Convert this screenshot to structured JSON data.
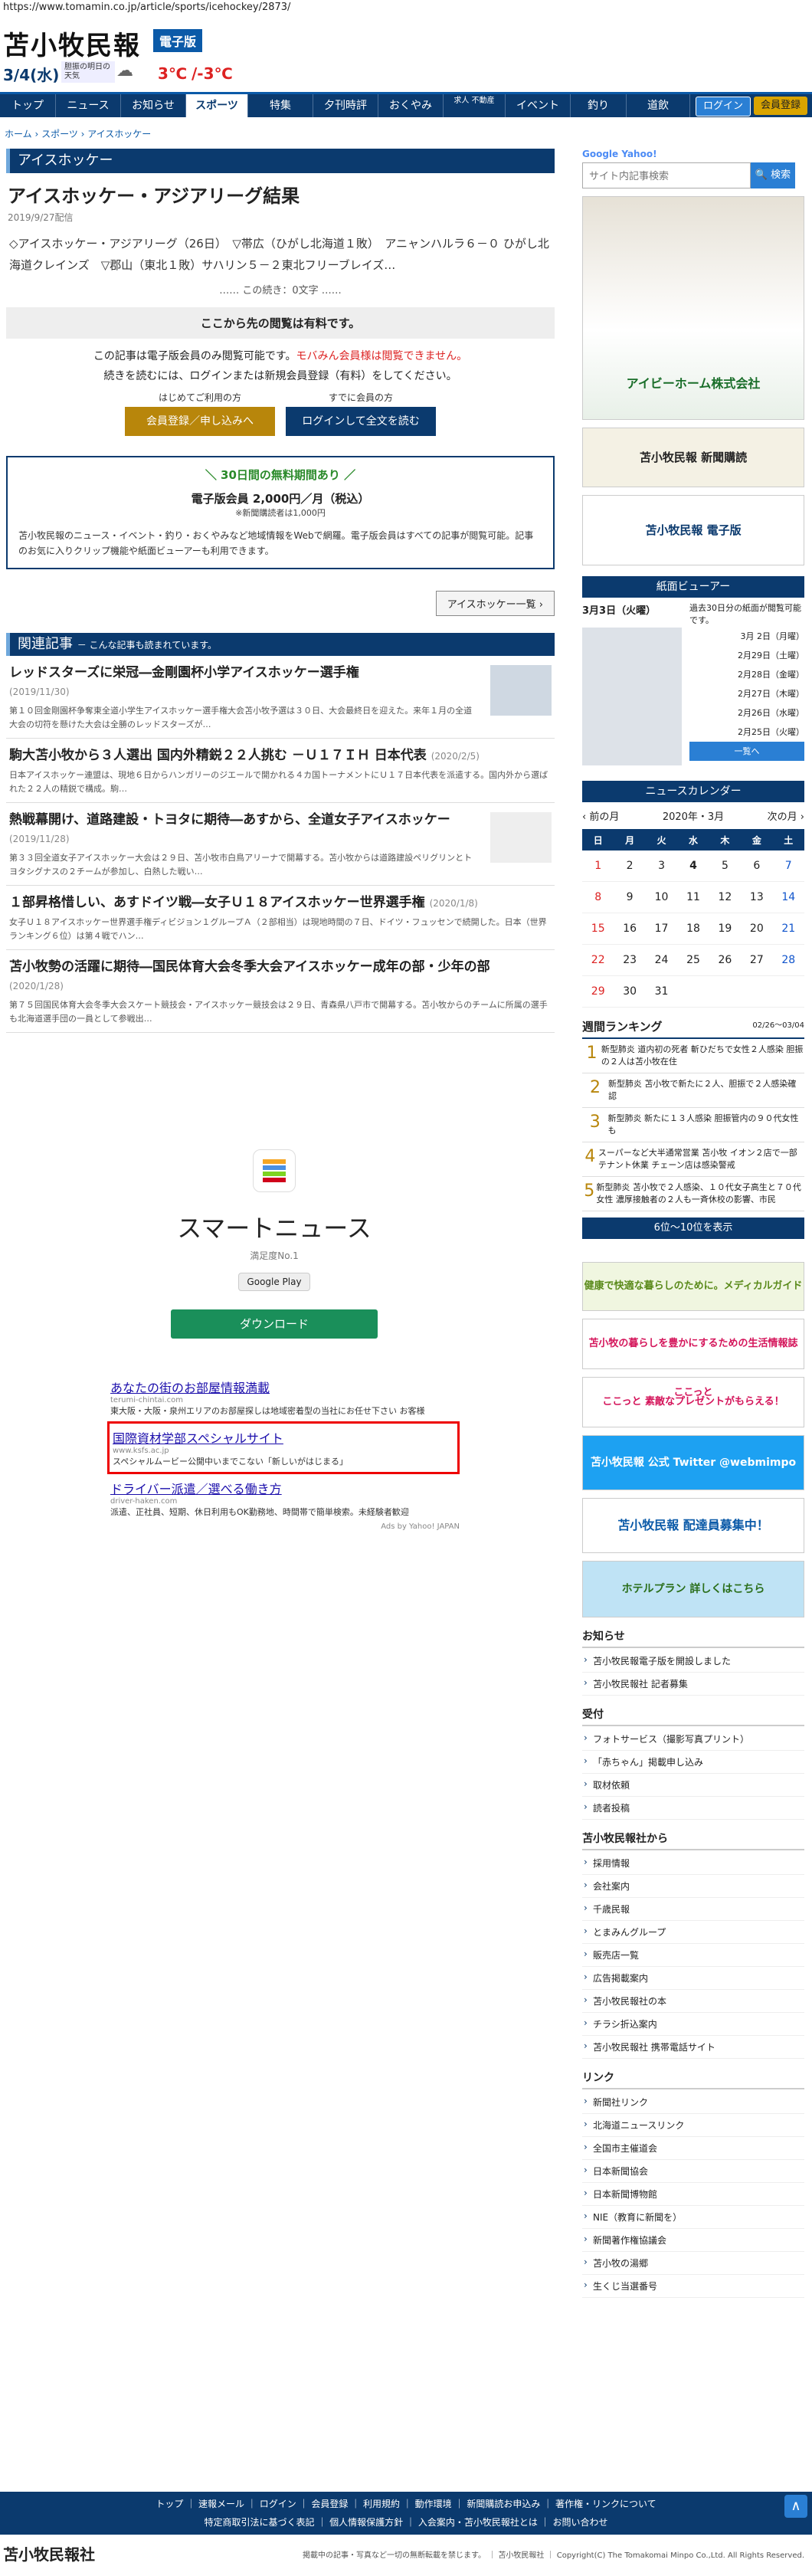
{
  "url": "https://www.tomamin.co.jp/article/sports/icehockey/2873/",
  "masthead": {
    "logo": "苫小牧民報",
    "edition": "電子版",
    "weather_date": "3/4(水)",
    "weather_label": "胆振の明日の天気",
    "temp_high": "3℃",
    "temp_low": "/-3℃"
  },
  "nav": {
    "items": [
      "トップ",
      "ニュース",
      "お知らせ",
      "スポーツ",
      "特集",
      "夕刊時評",
      "おくやみ",
      "求人 不動産",
      "イベント",
      "釣り",
      "道飲"
    ],
    "login": "ログイン",
    "member": "会員登録"
  },
  "breadcrumb": "ホーム › スポーツ › アイスホッケー",
  "section": "アイスホッケー",
  "article": {
    "title": "アイスホッケー・アジアリーグ結果",
    "date": "2019/9/27配信",
    "lead": "◇アイスホッケー・アジアリーグ（26日）　▽帯広（ひがし北海道１敗）　アニャンハルラ６－０ ひがし北海道クレインズ　▽郡山（東北１敗）サハリン５－２東北フリーブレイズ…",
    "chars": "…… この続き：0文字 ……",
    "paywall": "ここから先の閲覧は有料です。",
    "paytext_a": "この記事は電子版会員のみ閲覧可能です。",
    "paytext_red": "モバみん会員様は閲覧できません。",
    "paytext_b": "続きを読むには、ログインまたは新規会員登録（有料）をしてください。",
    "first_label": "はじめてご利用の方",
    "first_btn": "会員登録／申し込みへ",
    "member_label": "すでに会員の方",
    "member_btn": "ログインして全文を読む",
    "trial_title": "＼ 30日間の無料期間あり ／",
    "trial_price": "電子版会員 2,000円／月（税込）",
    "trial_note": "※新聞購読者は1,000円",
    "trial_desc": "苫小牧民報のニュース・イベント・釣り・おくやみなど地域情報をWebで網羅。電子版会員はすべての記事が閲覧可能。記事のお気に入りクリップ機能や紙面ビューアーも利用できます。",
    "back_btn": "アイスホッケー一覧 ›"
  },
  "related": {
    "header": "関連記事",
    "sub": "－ こんな記事も読まれています。",
    "items": [
      {
        "title": "レッドスターズに栄冠―金剛園杯小学アイスホッケー選手権",
        "date": "(2019/11/30)",
        "text": "第１０回金剛園杯争奪東全道小学生アイスホッケー選手権大会苫小牧予選は３０日、大会最終日を迎えた。来年１月の全道大会の切符を懸けた大会は全勝のレッドスターズが…"
      },
      {
        "title": "駒大苫小牧から３人選出 国内外精鋭２２人挑む －Ｕ１７ＩＨ 日本代表",
        "date": "(2020/2/5)",
        "text": "日本アイスホッケー連盟は、現地６日からハンガリーのジエールで開かれる４カ国トーナメントにＵ１７日本代表を派遣する。国内外から選ばれた２２人の精鋭で構成。駒…"
      },
      {
        "title": "熱戦幕開け、道路建設・トヨタに期待―あすから、全道女子アイスホッケー",
        "date": "(2019/11/28)",
        "text": "第３３回全道女子アイスホッケー大会は２９日、苫小牧市白鳥アリーナで開幕する。苫小牧からは道路建設ペリグリンとトヨタシグナスの２チームが参加し、白熱した戦い…"
      },
      {
        "title": "１部昇格惜しい、あすドイツ戦―女子Ｕ１８アイスホッケー世界選手権",
        "date": "(2020/1/8)",
        "text": "女子Ｕ１８アイスホッケー世界選手権ディビジョン１グループＡ（２部相当）は現地時間の７日、ドイツ・フュッセンで続開した。日本（世界ランキング６位）は第４戦でハン…"
      },
      {
        "title": "苫小牧勢の活躍に期待―国民体育大会冬季大会アイスホッケー成年の部・少年の部",
        "date": "(2020/1/28)",
        "text": "第７５回国民体育大会冬季大会スケート競技会・アイスホッケー競技会は２９日、青森県八戸市で開幕する。苫小牧からのチームに所属の選手も北海道選手団の一員として参戦出…"
      }
    ]
  },
  "smartnews": {
    "title": "スマートニュース",
    "sub": "満足度No.1",
    "gplay": "Google Play",
    "download": "ダウンロード"
  },
  "ads": {
    "items": [
      {
        "title": "あなたの街のお部屋情報満載",
        "url": "terumi-chintai.com",
        "text": "東大阪・大阪・泉州エリアのお部屋探しは地域密着型の当社にお任せ下さい お客様"
      },
      {
        "title": "国際資材学部スペシャルサイト",
        "url": "www.ksfs.ac.jp",
        "text": "スペシャルムービー公開中いまでこない「新しいがはじまる」"
      },
      {
        "title": "ドライバー派遣／選べる働き方",
        "url": "driver-haken.com",
        "text": "派遣、正社員、短期、休日利用もOK勤務地、時間帯で簡単検索。未経験者歓迎"
      }
    ],
    "footer": "Ads by Yahoo! JAPAN"
  },
  "side": {
    "search_brand": "Google Yahoo!",
    "search_placeholder": "サイト内記事検索",
    "search_btn": "検索",
    "ad1": "アイビーホーム株式会社",
    "ad2": "苫小牧民報 新聞購読",
    "ad3": "苫小牧民報 電子版",
    "viewer_title": "紙面ビューアー",
    "viewer_date": "3月3日（火曜）",
    "viewer_note": "過去30日分の紙面が閲覧可能です。",
    "viewer_list": [
      "3月 2日（月曜）",
      "2月29日（土曜）",
      "2月28日（金曜）",
      "2月27日（木曜）",
      "2月26日（水曜）",
      "2月25日（火曜）"
    ],
    "viewer_more": "一覧へ",
    "cal_title": "ニュースカレンダー",
    "cal_prev": "‹ 前の月",
    "cal_month": "2020年・3月",
    "cal_next": "次の月 ›",
    "cal_week": [
      "日",
      "月",
      "火",
      "水",
      "木",
      "金",
      "土"
    ],
    "cal_days": [
      [
        "1",
        "2",
        "3",
        "4",
        "5",
        "6",
        "7"
      ],
      [
        "8",
        "9",
        "10",
        "11",
        "12",
        "13",
        "14"
      ],
      [
        "15",
        "16",
        "17",
        "18",
        "19",
        "20",
        "21"
      ],
      [
        "22",
        "23",
        "24",
        "25",
        "26",
        "27",
        "28"
      ],
      [
        "29",
        "30",
        "31",
        "",
        "",
        "",
        ""
      ]
    ],
    "rank_title": "週間ランキング",
    "rank_range": "02/26～03/04",
    "rank_items": [
      {
        "n": "1",
        "t": "新型肺炎 道内初の死者 斬ひだちで女性２人感染 胆振の２人は苫小牧在住"
      },
      {
        "n": "2",
        "t": "新型肺炎 苫小牧で新たに２人、胆振で２人感染確認"
      },
      {
        "n": "3",
        "t": "新型肺炎 新たに１３人感染 胆振管内の９０代女性も"
      },
      {
        "n": "4",
        "t": "スーパーなど大半通常営業 苫小牧 イオン２店で一部テナント休業 チェーン店は感染警戒"
      },
      {
        "n": "5",
        "t": "新型肺炎 苫小牧で２人感染、１０代女子高生と７０代女性 濃厚接触者の２人も一斉休校の影響、市民"
      }
    ],
    "rank_more": "6位～10位を表示",
    "banners": [
      "健康で快適な暮らしのために。メディカルガイド",
      "苫小牧の暮らしを豊かにするための生活情報誌 ここっと",
      "ここっと 素敵なプレゼントがもらえる！",
      "苫小牧民報 公式 Twitter @webmimpo",
      "苫小牧民報 配達員募集中！",
      "ホテルプラン 詳しくはこちら"
    ],
    "links": [
      {
        "h": "お知らせ",
        "items": [
          "苫小牧民報電子版を開設しました",
          "苫小牧民報社 記者募集"
        ]
      },
      {
        "h": "受付",
        "items": [
          "フォトサービス（撮影写真プリント）",
          "「赤ちゃん」掲載申し込み",
          "取材依頼",
          "読者投稿"
        ]
      },
      {
        "h": "苫小牧民報社から",
        "items": [
          "採用情報",
          "会社案内",
          "千歳民報",
          "とまみんグループ",
          "販売店一覧",
          "広告掲載案内",
          "苫小牧民報社の本",
          "チラシ折込案内",
          "苫小牧民報社 携帯電話サイト"
        ]
      },
      {
        "h": "リンク",
        "items": [
          "新聞社リンク",
          "北海道ニュースリンク",
          "全国市主催道会",
          "日本新聞協会",
          "日本新聞博物館",
          "NIE（教育に新聞を）",
          "新聞著作権協議会",
          "苫小牧の湯郷",
          "生くじ当選番号"
        ]
      }
    ]
  },
  "footer": {
    "row1": [
      "トップ",
      "速報メール",
      "ログイン",
      "会員登録",
      "利用規約",
      "動作環境",
      "新聞購読お申込み",
      "著作権・リンクについて"
    ],
    "row2": [
      "特定商取引法に基づく表記",
      "個人情報保護方針",
      "入会案内・苫小牧民報社とは",
      "お問い合わせ"
    ],
    "copyright": "掲載中の記事・写真など一切の無断転載を禁じます。 ｜ 苫小牧民報社 ｜ Copyright(C) The Tomakomai Minpo Co.,Ltd. All Rights Reserved.",
    "logo": "苫小牧民報社",
    "totop": "∧"
  }
}
